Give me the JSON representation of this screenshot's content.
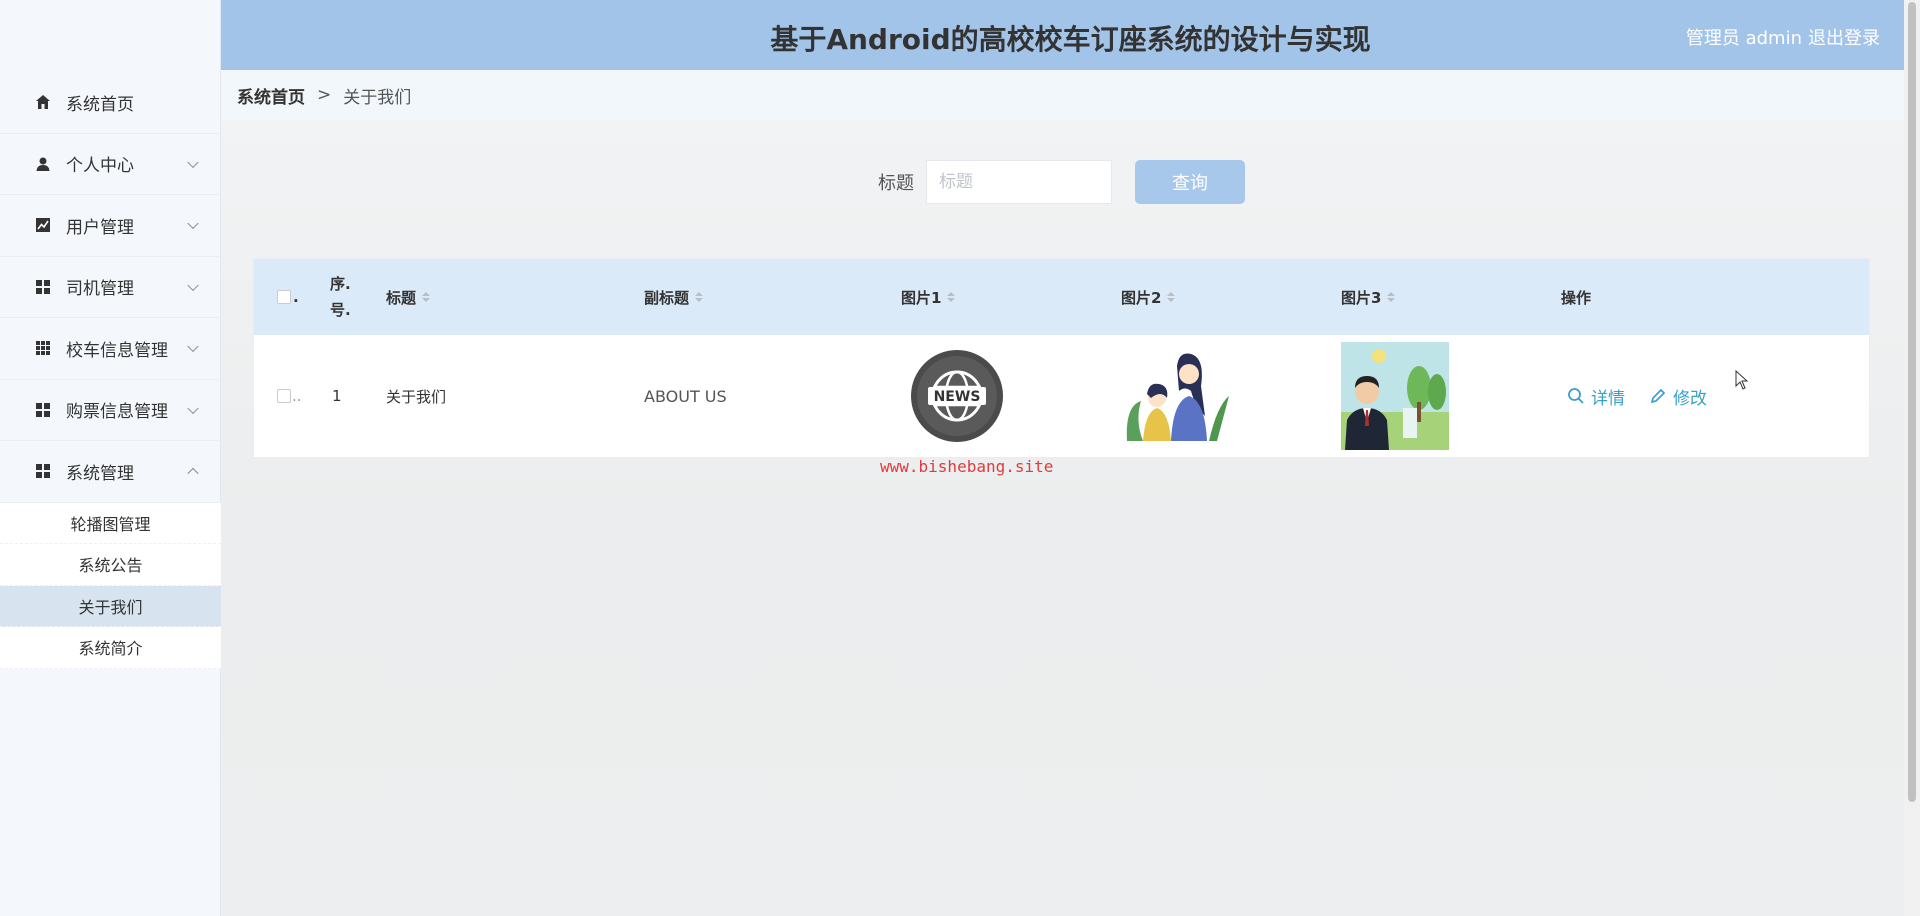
{
  "header": {
    "title": "基于Android的高校校车订座系统的设计与实现",
    "user": "管理员 admin",
    "logout": "退出登录"
  },
  "breadcrumb": {
    "home": "系统首页",
    "sep": ">",
    "current": "关于我们"
  },
  "sidebar": {
    "items": [
      {
        "label": "系统首页",
        "icon": "home-icon"
      },
      {
        "label": "个人中心",
        "icon": "user-icon"
      },
      {
        "label": "用户管理",
        "icon": "chart-icon"
      },
      {
        "label": "司机管理",
        "icon": "grid-icon"
      },
      {
        "label": "校车信息管理",
        "icon": "apps-icon"
      },
      {
        "label": "购票信息管理",
        "icon": "grid-icon"
      },
      {
        "label": "系统管理",
        "icon": "grid-icon"
      }
    ],
    "submenu": [
      "轮播图管理",
      "系统公告",
      "关于我们",
      "系统简介"
    ]
  },
  "search": {
    "label": "标题",
    "placeholder": "标题",
    "button": "查询"
  },
  "table": {
    "headers": {
      "index_line1": "序.",
      "index_line2": "号.",
      "title": "标题",
      "subtitle": "副标题",
      "img1": "图片1",
      "img2": "图片2",
      "img3": "图片3",
      "ops": "操作"
    },
    "rows": [
      {
        "index": "1",
        "title": "关于我们",
        "subtitle": "ABOUT US",
        "img1_text": "NEWS",
        "detail": "详情",
        "edit": "修改"
      }
    ]
  },
  "watermark": "www.bishebang.site",
  "colors": {
    "header": "#a3c4e9",
    "accent": "#3aa0c9",
    "button": "#a7c8ea"
  }
}
